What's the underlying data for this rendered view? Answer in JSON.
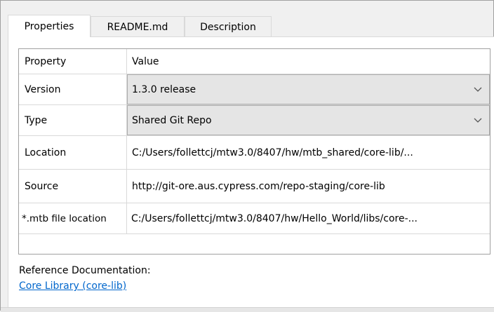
{
  "tabs": [
    {
      "label": "Properties",
      "active": true
    },
    {
      "label": "README.md",
      "active": false
    },
    {
      "label": "Description",
      "active": false
    }
  ],
  "grid": {
    "header": {
      "property": "Property",
      "value": "Value"
    },
    "rows": [
      {
        "name": "Version",
        "value": "1.3.0 release",
        "editor": "combo"
      },
      {
        "name": "Type",
        "value": "Shared Git Repo",
        "editor": "combo"
      },
      {
        "name": "Location",
        "value": "C:/Users/follettcj/mtw3.0/8407/hw/mtb_shared/core-lib/..."
      },
      {
        "name": "Source",
        "value": "http://git-ore.aus.cypress.com/repo-staging/core-lib"
      },
      {
        "name": "*.mtb file location",
        "value": "C:/Users/follettcj/mtw3.0/8407/hw/Hello_World/libs/core-..."
      }
    ]
  },
  "reference": {
    "label": "Reference Documentation:",
    "link": "Core Library (core-lib)"
  },
  "colors": {
    "link": "#0066cc",
    "combo_bg": "#e5e5e5",
    "grid_border": "#a0a0a0"
  }
}
